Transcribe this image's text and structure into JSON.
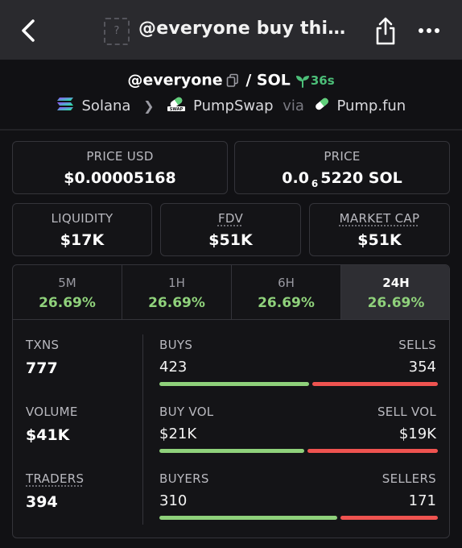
{
  "topbar": {
    "title": "@everyone buy this...",
    "thumb_placeholder": "?",
    "icons": [
      "back-chevron-icon",
      "share-icon",
      "more-dots-icon"
    ]
  },
  "pair": {
    "base": "@everyone",
    "separator": "/",
    "quote": "SOL",
    "age": "36s",
    "chain": "Solana",
    "dex": "PumpSwap",
    "via": "via",
    "launchpad": "Pump.fun"
  },
  "price": {
    "usd_label": "PRICE USD",
    "usd_value": "$0.00005168",
    "native_label": "PRICE",
    "native_prefix": "0.0",
    "native_zeros": "6",
    "native_digits": "5220 SOL"
  },
  "metrics": {
    "liquidity_label": "LIQUIDITY",
    "liquidity_value": "$17K",
    "fdv_label": "FDV",
    "fdv_value": "$51K",
    "mcap_label": "MARKET CAP",
    "mcap_value": "$51K"
  },
  "tabs": [
    {
      "label": "5M",
      "value": "26.69%"
    },
    {
      "label": "1H",
      "value": "26.69%"
    },
    {
      "label": "6H",
      "value": "26.69%"
    },
    {
      "label": "24H",
      "value": "26.69%",
      "active": true
    }
  ],
  "stats": {
    "txns_label": "TXNS",
    "txns_value": "777",
    "volume_label": "VOLUME",
    "volume_value": "$41K",
    "traders_label": "TRADERS",
    "traders_value": "394",
    "buys_label": "BUYS",
    "buys_value": "423",
    "sells_label": "SELLS",
    "sells_value": "354",
    "buy_vol_label": "BUY VOL",
    "buy_vol_value": "$21K",
    "sell_vol_label": "SELL VOL",
    "sell_vol_value": "$19K",
    "buyers_label": "BUYERS",
    "buyers_value": "310",
    "sellers_label": "SELLERS",
    "sellers_value": "171"
  },
  "ratios": {
    "buys_share": 0.545,
    "buy_vol_share": 0.525,
    "buyers_share": 0.645
  },
  "colors": {
    "positive": "#8fd17b",
    "negative": "#ef5350",
    "age_green": "#4cbe78"
  }
}
